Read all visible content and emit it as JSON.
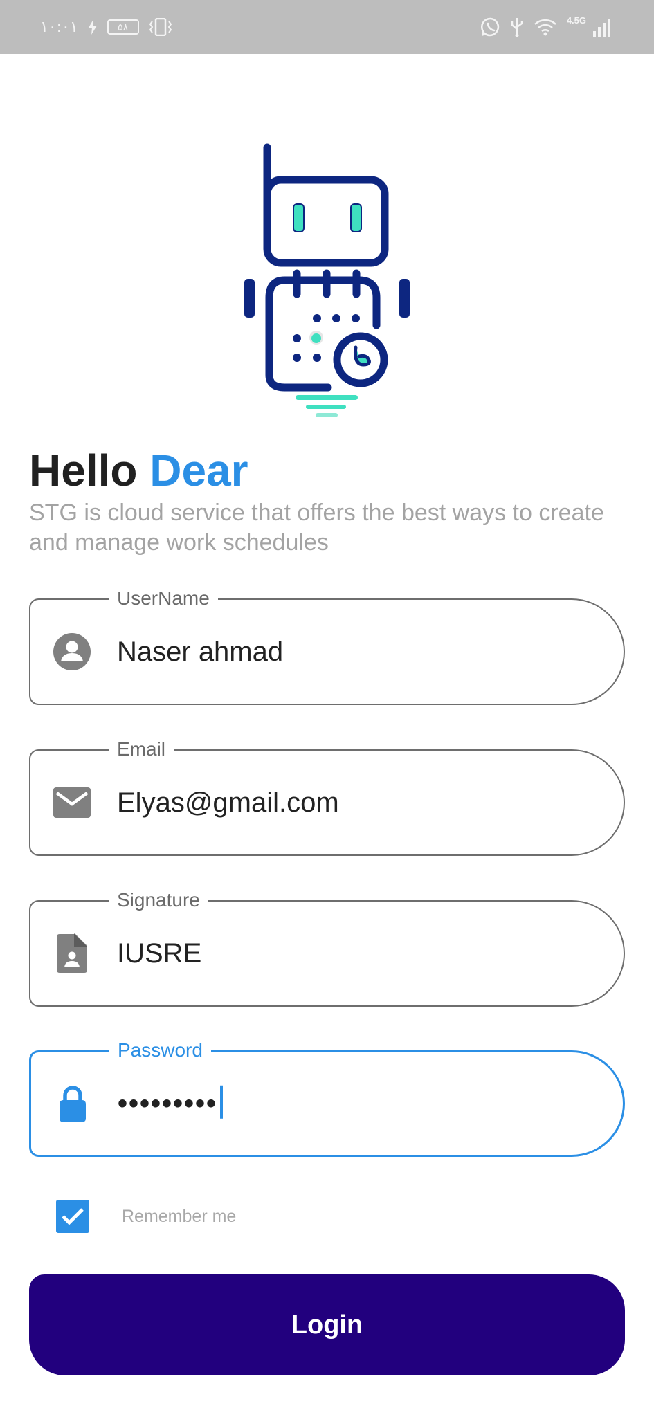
{
  "status_bar": {
    "time": "۱۰:۰۱",
    "battery": "۵۸",
    "network": "4.5G"
  },
  "logo": {
    "icon": "robot-calendar-logo",
    "colors": {
      "primary": "#0d2680",
      "accent": "#3fe0c0"
    }
  },
  "header": {
    "title_part1": "Hello",
    "title_part2": "Dear",
    "subtitle": "STG is cloud service that offers the best ways to create and manage work schedules"
  },
  "form": {
    "username": {
      "label": "UserName",
      "value": "Naser ahmad",
      "icon": "person-icon"
    },
    "email": {
      "label": "Email",
      "value": "Elyas@gmail.com",
      "icon": "mail-icon"
    },
    "signature": {
      "label": "Signature",
      "value": "IUSRE",
      "icon": "document-person-icon"
    },
    "password": {
      "label": "Password",
      "value": "•••••••••",
      "icon": "lock-icon"
    },
    "remember": {
      "label": "Remember me",
      "checked": true
    },
    "login_label": "Login"
  },
  "colors": {
    "accent": "#2b8fe5",
    "button": "#22007e",
    "border": "#6e6e6e"
  }
}
